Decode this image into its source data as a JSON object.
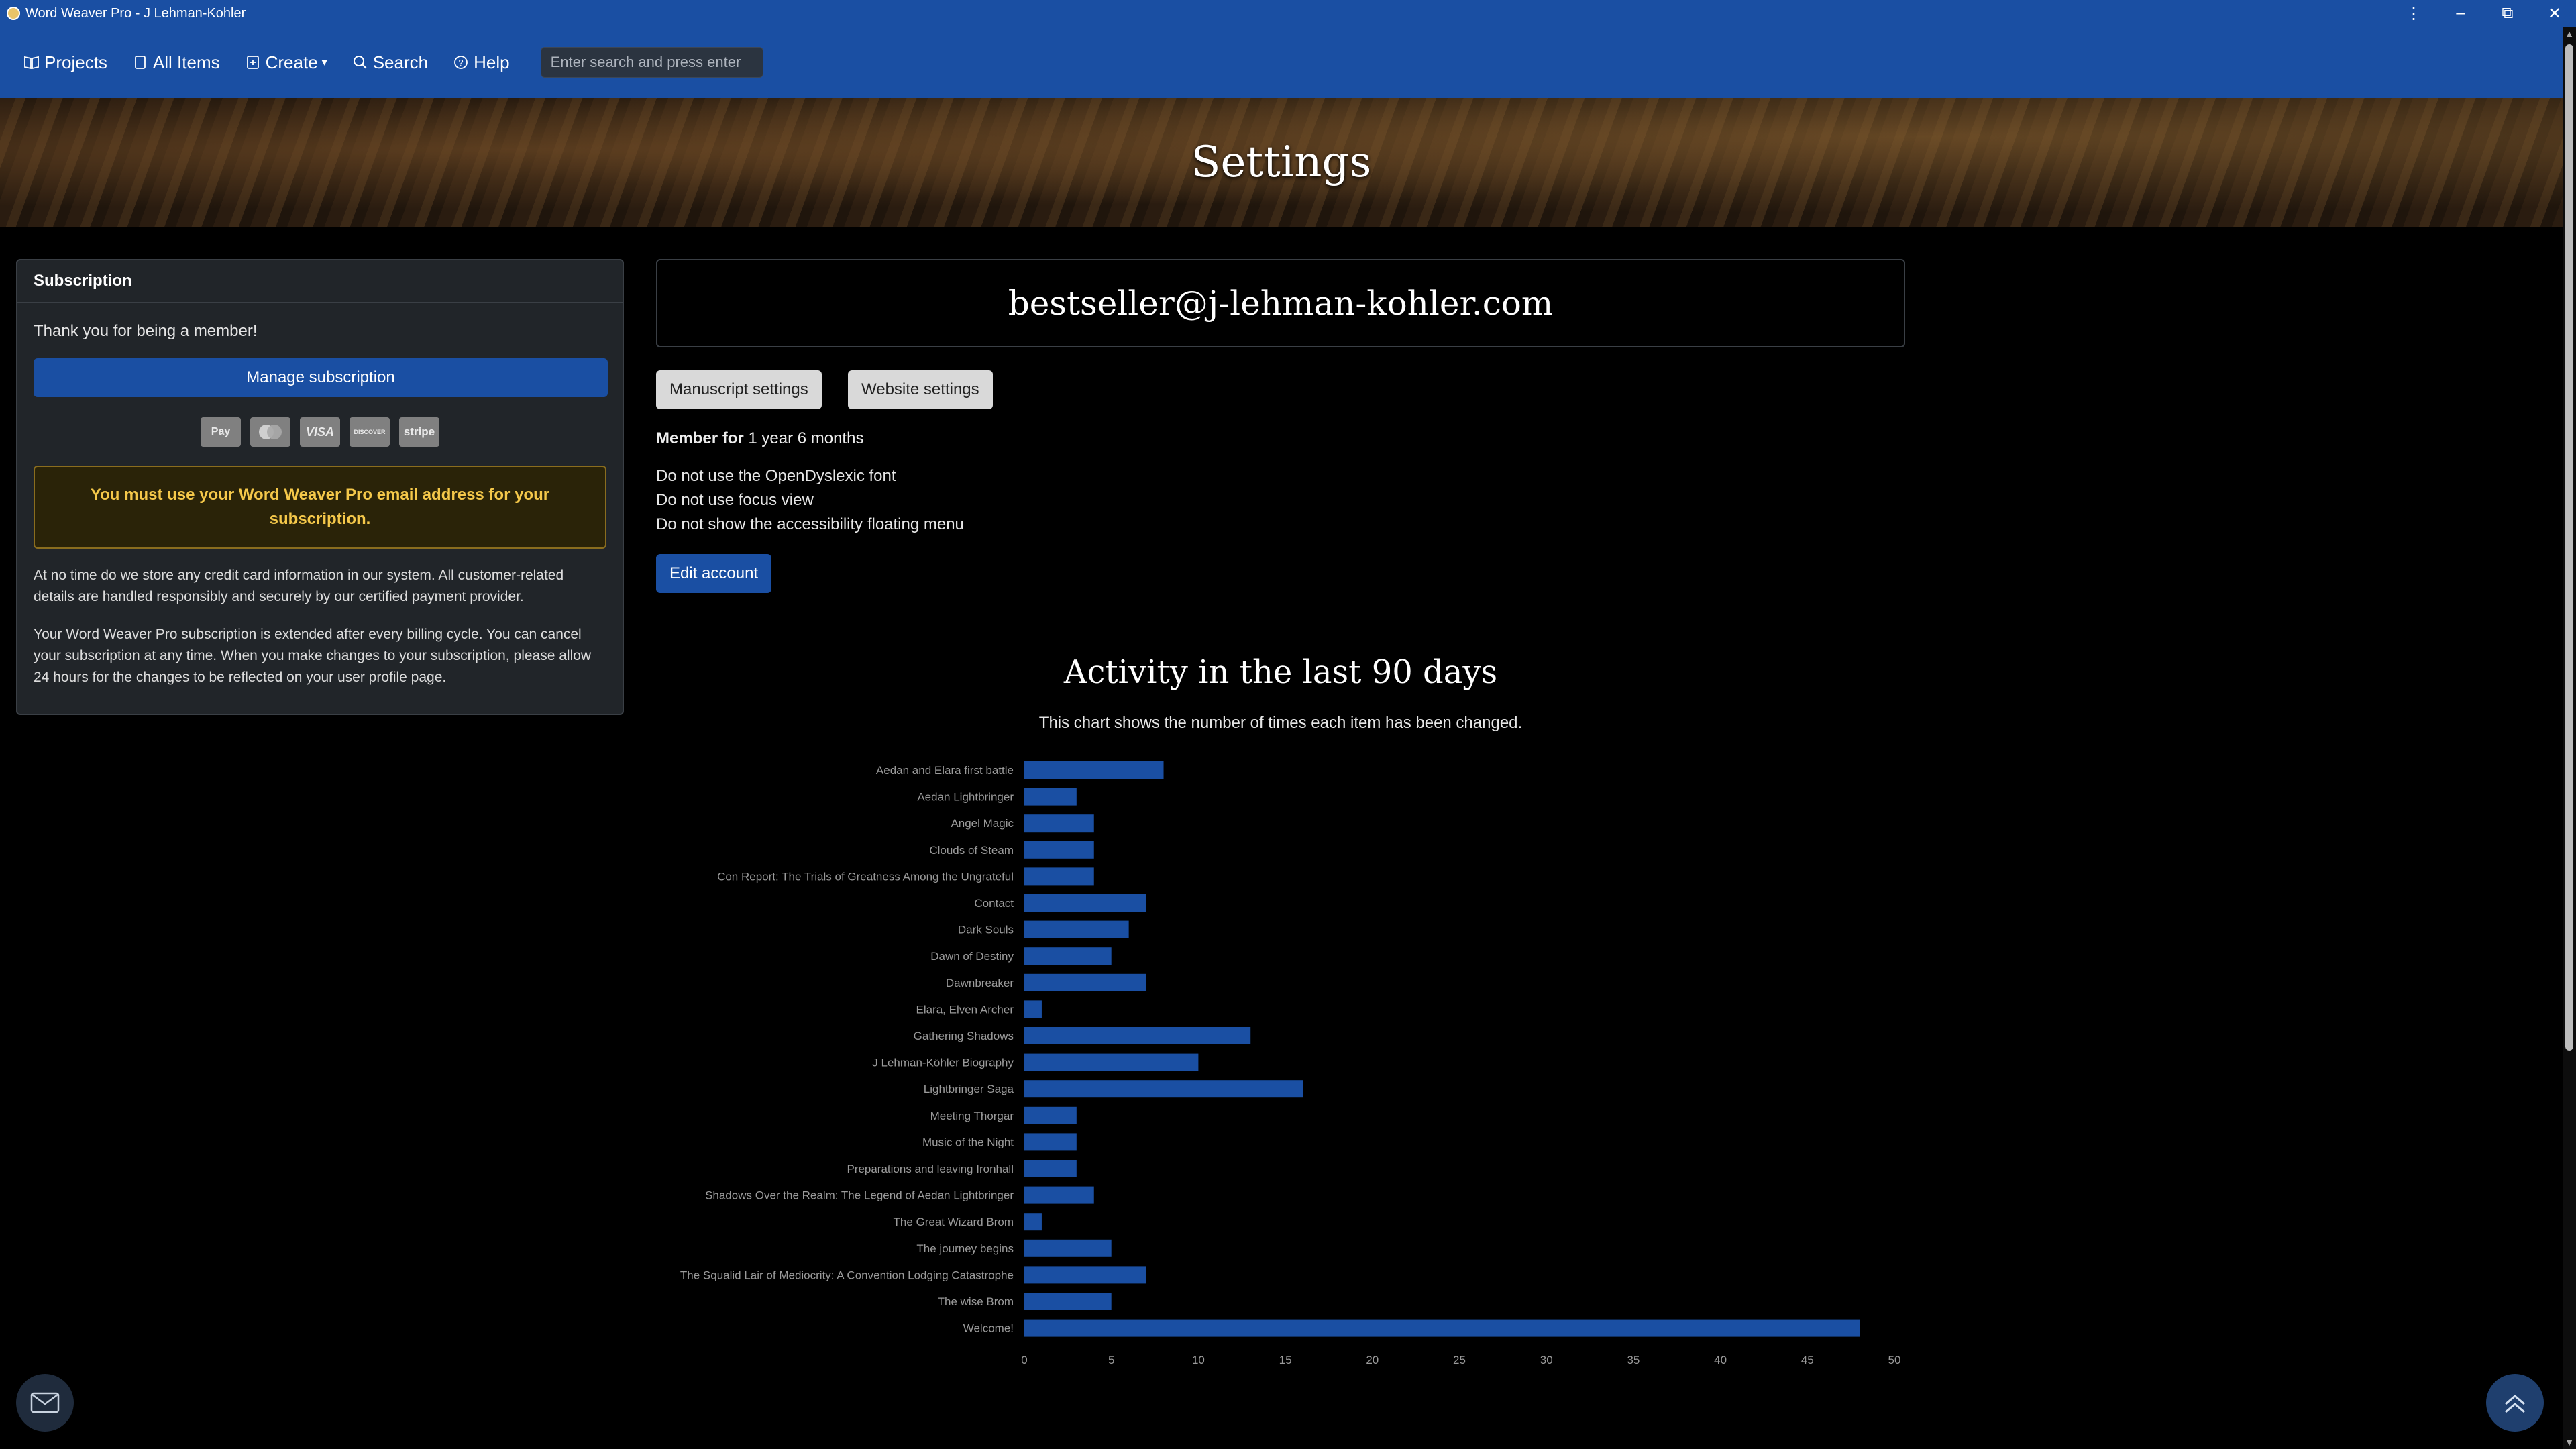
{
  "window": {
    "title": "Word Weaver Pro - J Lehman-Kohler"
  },
  "nav": {
    "items": [
      {
        "label": "Projects",
        "icon": "book-icon"
      },
      {
        "label": "All Items",
        "icon": "document-icon"
      },
      {
        "label": "Create",
        "icon": "plus-square-icon"
      },
      {
        "label": "Search",
        "icon": "search-icon"
      },
      {
        "label": "Help",
        "icon": "help-icon"
      }
    ],
    "search_placeholder": "Enter search and press enter"
  },
  "hero": {
    "title": "Settings"
  },
  "subscription": {
    "header": "Subscription",
    "thanks": "Thank you for being a member!",
    "manage_label": "Manage subscription",
    "pay_icons": [
      "Pay",
      "MC",
      "VISA",
      "DISCOVER",
      "stripe"
    ],
    "warning": "You must use your Word Weaver Pro email address for your subscription.",
    "para1": "At no time do we store any credit card information in our system. All customer-related details are handled responsibly and securely by our certified payment provider.",
    "para2": "Your Word Weaver Pro subscription is extended after every billing cycle. You can cancel your subscription at any time. When you make changes to your subscription, please allow 24 hours for the changes to be reflected on your user profile page."
  },
  "account": {
    "email": "bestseller@j-lehman-kohler.com",
    "manuscript_settings": "Manuscript settings",
    "website_settings": "Website settings",
    "member_label": "Member for",
    "member_value": "1 year 6 months",
    "prefs": [
      "Do not use the OpenDyslexic font",
      "Do not use focus view",
      "Do not show the accessibility floating menu"
    ],
    "edit_label": "Edit account"
  },
  "chart_data": {
    "type": "bar",
    "orientation": "horizontal",
    "title": "Activity in the last 90 days",
    "subtitle": "This chart shows the number of times each item has been changed.",
    "categories": [
      "Aedan and Elara first battle",
      "Aedan Lightbringer",
      "Angel Magic",
      "Clouds of Steam",
      "Con Report: The Trials of Greatness Among the Ungrateful",
      "Contact",
      "Dark Souls",
      "Dawn of Destiny",
      "Dawnbreaker",
      "Elara, Elven Archer",
      "Gathering Shadows",
      "J Lehman-Köhler Biography",
      "Lightbringer Saga",
      "Meeting Thorgar",
      "Music of the Night",
      "Preparations and leaving Ironhall",
      "Shadows Over the Realm: The Legend of Aedan Lightbringer",
      "The Great Wizard Brom",
      "The journey begins",
      "The Squalid Lair of Mediocrity: A Convention Lodging Catastrophe",
      "The wise Brom",
      "Welcome!"
    ],
    "values": [
      8,
      3,
      4,
      4,
      4,
      7,
      6,
      5,
      7,
      1,
      13,
      10,
      16,
      3,
      3,
      3,
      4,
      1,
      5,
      7,
      5,
      48
    ],
    "xlim": [
      0,
      50
    ],
    "xticks": [
      0,
      5,
      10,
      15,
      20,
      25,
      30,
      35,
      40,
      45,
      50
    ],
    "bar_color": "#1a4fa3"
  }
}
